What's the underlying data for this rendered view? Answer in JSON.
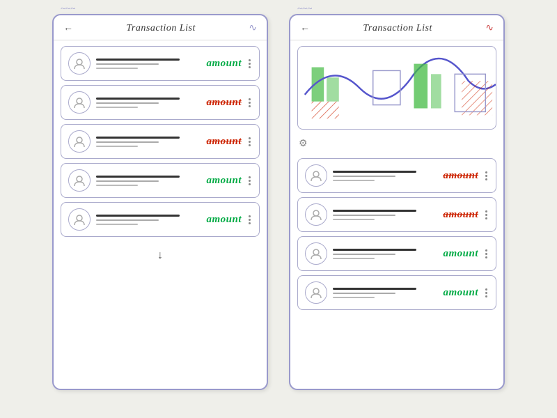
{
  "app": {
    "title": "Transaction List"
  },
  "left_phone": {
    "logo": "~~~",
    "back_label": "←",
    "title": "Transaction List",
    "chart_icon": "∿",
    "transactions": [
      {
        "amount": "amount",
        "amount_color": "green",
        "id": 1
      },
      {
        "amount": "amount",
        "amount_color": "red",
        "id": 2
      },
      {
        "amount": "amount",
        "amount_color": "red",
        "id": 3
      },
      {
        "amount": "amount",
        "amount_color": "green",
        "id": 4
      },
      {
        "amount": "amount",
        "amount_color": "green",
        "id": 5
      }
    ],
    "scroll_icon": "↓"
  },
  "right_phone": {
    "logo": "~~~",
    "back_label": "←",
    "title": "Transaction List",
    "chart_icon": "∿",
    "gear_icon": "⚙",
    "transactions": [
      {
        "amount": "amount",
        "amount_color": "red",
        "id": 1
      },
      {
        "amount": "amount",
        "amount_color": "red",
        "id": 2
      },
      {
        "amount": "amount",
        "amount_color": "green",
        "id": 3
      },
      {
        "amount": "amount",
        "amount_color": "green",
        "id": 4
      }
    ]
  }
}
